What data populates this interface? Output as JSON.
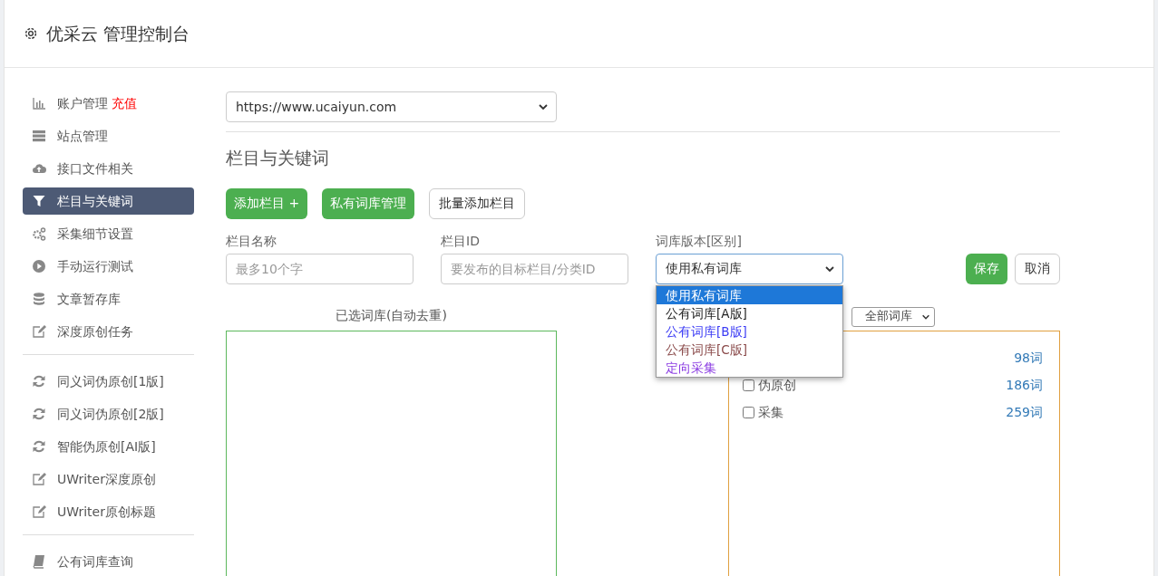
{
  "header": {
    "title": "优采云 管理控制台"
  },
  "sidebar": {
    "groups": [
      {
        "items": [
          {
            "label": "账户管理",
            "badge": "充值",
            "selected": false
          },
          {
            "label": "站点管理",
            "selected": false
          },
          {
            "label": "接口文件相关",
            "selected": false
          },
          {
            "label": "栏目与关键词",
            "selected": true
          },
          {
            "label": "采集细节设置",
            "selected": false
          },
          {
            "label": "手动运行测试",
            "selected": false
          },
          {
            "label": "文章暂存库",
            "selected": false
          },
          {
            "label": "深度原创任务",
            "selected": false
          }
        ]
      },
      {
        "items": [
          {
            "label": "同义词伪原创[1版]",
            "selected": false
          },
          {
            "label": "同义词伪原创[2版]",
            "selected": false
          },
          {
            "label": "智能伪原创[AI版]",
            "selected": false
          },
          {
            "label": "UWriter深度原创",
            "selected": false
          },
          {
            "label": "UWriter原创标题",
            "selected": false
          }
        ]
      },
      {
        "items": [
          {
            "label": "公有词库查询",
            "selected": false
          }
        ]
      }
    ]
  },
  "site_select": {
    "value": "https://www.ucaiyun.com"
  },
  "section_title": "栏目与关键词",
  "buttons": [
    {
      "label": "添加栏目 +",
      "kind": "primary"
    },
    {
      "label": "私有词库管理",
      "kind": "primary"
    },
    {
      "label": "批量添加栏目",
      "kind": "outline"
    }
  ],
  "form": {
    "name": {
      "label": "栏目名称",
      "placeholder": "最多10个字"
    },
    "id": {
      "label": "栏目ID",
      "placeholder": "要发布的目标栏目/分类ID"
    },
    "version": {
      "label": "词库版本[区别]",
      "value": "使用私有词库",
      "expanded": true,
      "options": [
        {
          "label": "使用私有词库",
          "selected": true
        },
        {
          "label": "公有词库[A版]",
          "selected": false,
          "color": "#222222"
        },
        {
          "label": "公有词库[B版]",
          "selected": false,
          "color": "#3b3bf5"
        },
        {
          "label": "公有词库[C版]",
          "selected": false,
          "color": "#8a4a4a"
        },
        {
          "label": "定向采集",
          "selected": false,
          "color": "#8a3be2"
        }
      ]
    },
    "save": "保存",
    "cancel": "取消"
  },
  "selected_box": {
    "title": "已选词库(自动去重)"
  },
  "library_box": {
    "filter": "全部词库",
    "rows": [
      {
        "count": "98词"
      },
      {
        "label": "伪原创",
        "checked": false,
        "count": "186词"
      },
      {
        "label": "采集",
        "checked": false,
        "count": "259词"
      }
    ]
  }
}
